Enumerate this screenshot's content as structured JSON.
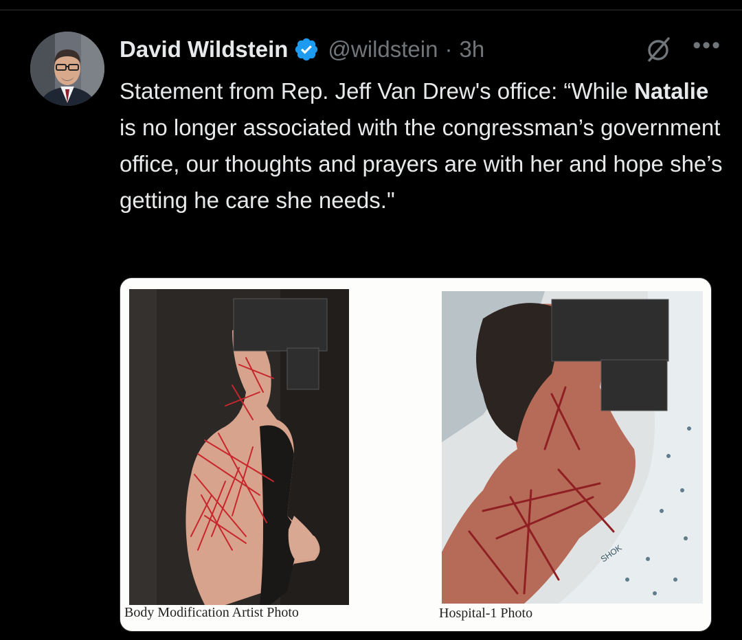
{
  "tweet": {
    "author_name": "David Wildstein",
    "handle": "@wildstein",
    "separator": "·",
    "time": "3h",
    "more_label": "•••",
    "text_part1": "Statement from Rep. Jeff Van Drew's office: “While ",
    "text_bold": "Natalie",
    "text_part2": " is no longer associated with the congressman’s government office, our thoughts and prayers are with her and hope she’s getting he care she needs.\""
  },
  "media": {
    "left_caption": "Body Modification Artist Photo",
    "right_caption": "Hospital-1 Photo",
    "gown_print": "SHOK"
  },
  "colors": {
    "background": "#000000",
    "verified_blue": "#1d9bf0",
    "text_primary": "#e7e9ea",
    "text_secondary": "#71767b"
  }
}
